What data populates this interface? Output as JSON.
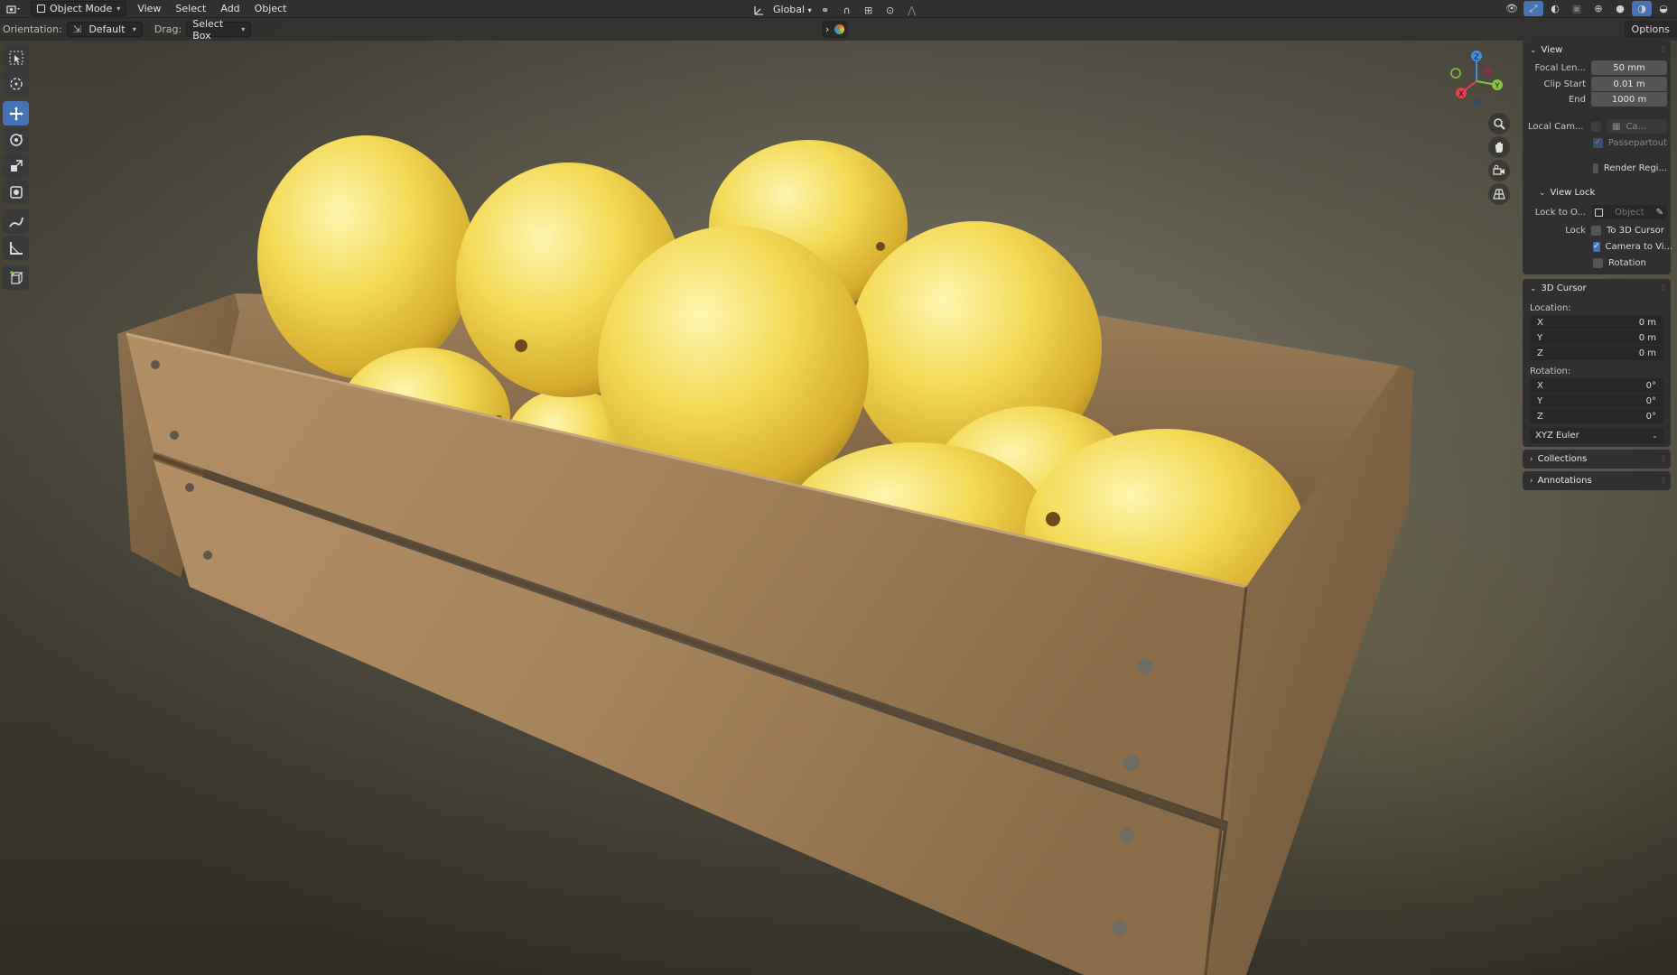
{
  "header": {
    "mode_label": "Object Mode",
    "menus": [
      "View",
      "Select",
      "Add",
      "Object"
    ],
    "transform_orientation": "Global"
  },
  "tool_header": {
    "orientation_label": "Orientation:",
    "orientation_value": "Default",
    "drag_label": "Drag:",
    "drag_value": "Select Box",
    "options_label": "Options"
  },
  "gizmo": {
    "z": "Z",
    "y": "Y",
    "x": "X"
  },
  "sidebar": {
    "view_panel": {
      "title": "View",
      "focal_label": "Focal Len...",
      "focal_value": "50 mm",
      "clip_start_label": "Clip Start",
      "clip_start_value": "0.01 m",
      "end_label": "End",
      "end_value": "1000 m",
      "local_cam_label": "Local Cam...",
      "local_cam_value": "Ca...",
      "passepartout_label": "Passepartout",
      "render_region_label": "Render Regi..."
    },
    "view_lock": {
      "title": "View Lock",
      "lock_to_label": "Lock to O...",
      "lock_to_placeholder": "Object",
      "lock_label": "Lock",
      "to_cursor_label": "To 3D Cursor",
      "camera_to_view_label": "Camera to Vi...",
      "rotation_label": "Rotation"
    },
    "cursor_panel": {
      "title": "3D Cursor",
      "location_label": "Location:",
      "loc_x_label": "X",
      "loc_x_value": "0 m",
      "loc_y_label": "Y",
      "loc_y_value": "0 m",
      "loc_z_label": "Z",
      "loc_z_value": "0 m",
      "rotation_label": "Rotation:",
      "rot_x_label": "X",
      "rot_x_value": "0°",
      "rot_y_label": "Y",
      "rot_y_value": "0°",
      "rot_z_label": "Z",
      "rot_z_value": "0°",
      "rotation_mode": "XYZ Euler"
    },
    "collections_title": "Collections",
    "annotations_title": "Annotations"
  },
  "colors": {
    "accent": "#4772b3",
    "axis_x": "#e0414a",
    "axis_y": "#8bc34a",
    "axis_z": "#3f8fe0",
    "melon": "#f0d24a",
    "wood": "#a8855e"
  },
  "icons": {
    "toolbar": [
      "select-box-icon",
      "cursor-icon",
      "move-icon",
      "rotate-icon",
      "scale-icon",
      "transform-icon",
      "annotate-icon",
      "measure-icon",
      "add-cube-icon"
    ],
    "nav": [
      "zoom-icon",
      "hand-pan-icon",
      "camera-icon",
      "grid-icon"
    ]
  }
}
